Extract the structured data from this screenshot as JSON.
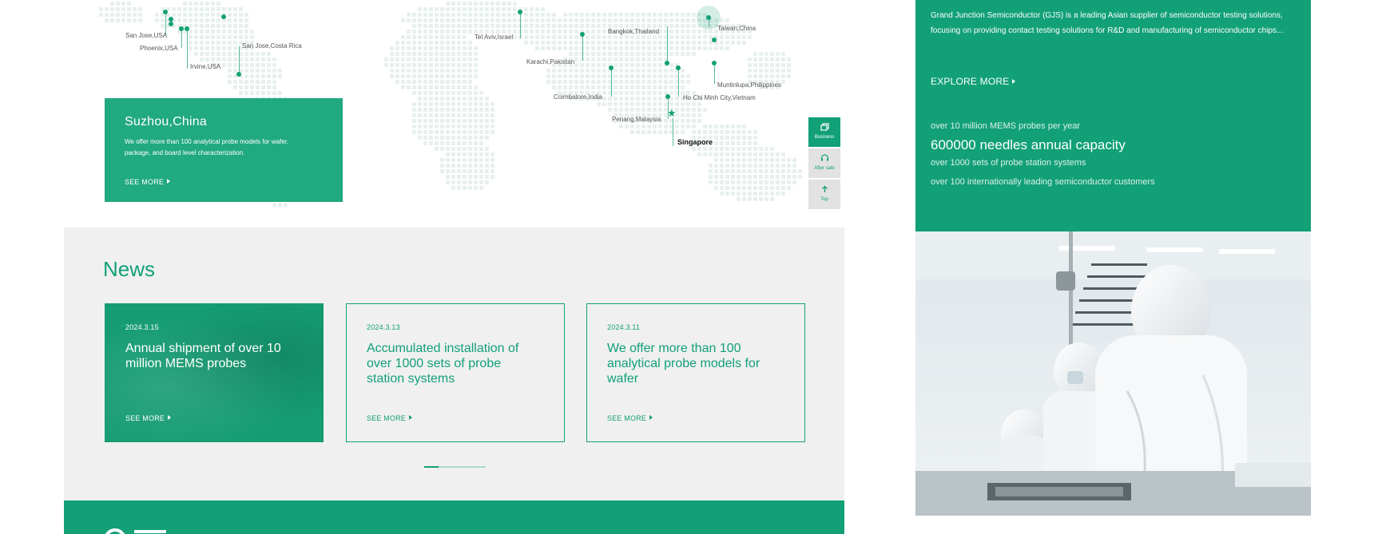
{
  "map": {
    "locations": [
      {
        "name": "San Jose,USA"
      },
      {
        "name": "Phoenix,USA"
      },
      {
        "name": "Irvine,USA"
      },
      {
        "name": "San Jose,Costa Rica"
      },
      {
        "name": "Tel Aviv,Israel"
      },
      {
        "name": "Karachi,Pakistan"
      },
      {
        "name": "Bangkok,Thailand"
      },
      {
        "name": "Taiwan,China"
      },
      {
        "name": "Muntinlupa,Philippines"
      },
      {
        "name": "Coimbatore,India"
      },
      {
        "name": "Ho Chi Minh City,Vietnam"
      },
      {
        "name": "Penang,Malaysia"
      },
      {
        "name": "Singapore"
      }
    ],
    "card": {
      "title": "Suzhou,China",
      "description": "We offer more than 100 analytical probe models for wafer, package, and board level characterization.",
      "see_more": "SEE MORE"
    }
  },
  "float_tools": [
    {
      "label": "Business",
      "icon": "window-icon"
    },
    {
      "label": "After sale",
      "icon": "headset-icon"
    },
    {
      "label": "Top",
      "icon": "arrow-up-icon"
    }
  ],
  "news": {
    "title": "News",
    "items": [
      {
        "date": "2024.3.15",
        "headline": "Annual shipment of over 10 million MEMS probes",
        "more": "SEE MORE"
      },
      {
        "date": "2024.3.13",
        "headline": "Accumulated installation of over 1000 sets of probe station systems",
        "more": "SEE MORE"
      },
      {
        "date": "2024.3.11",
        "headline": "We offer more than 100 analytical probe models for wafer",
        "more": "SEE MORE"
      }
    ],
    "pager": {
      "current": 1,
      "total": 4
    }
  },
  "about": {
    "description": "Grand Junction Semiconductor (GJS) is a leading Asian supplier of semiconductor testing solutions, focusing on providing contact testing solutions for R&D and manufacturing of semiconductor chips...",
    "explore": "EXPLORE MORE",
    "stats": [
      "over 10 million MEMS probes per year",
      "600000 needles annual capacity",
      "over 1000 sets of probe station systems",
      "over 100 internationally leading semiconductor customers"
    ]
  },
  "colors": {
    "brand_green": "#12a077",
    "card_green": "#21a97f",
    "news_bg": "#f0f0f0"
  }
}
